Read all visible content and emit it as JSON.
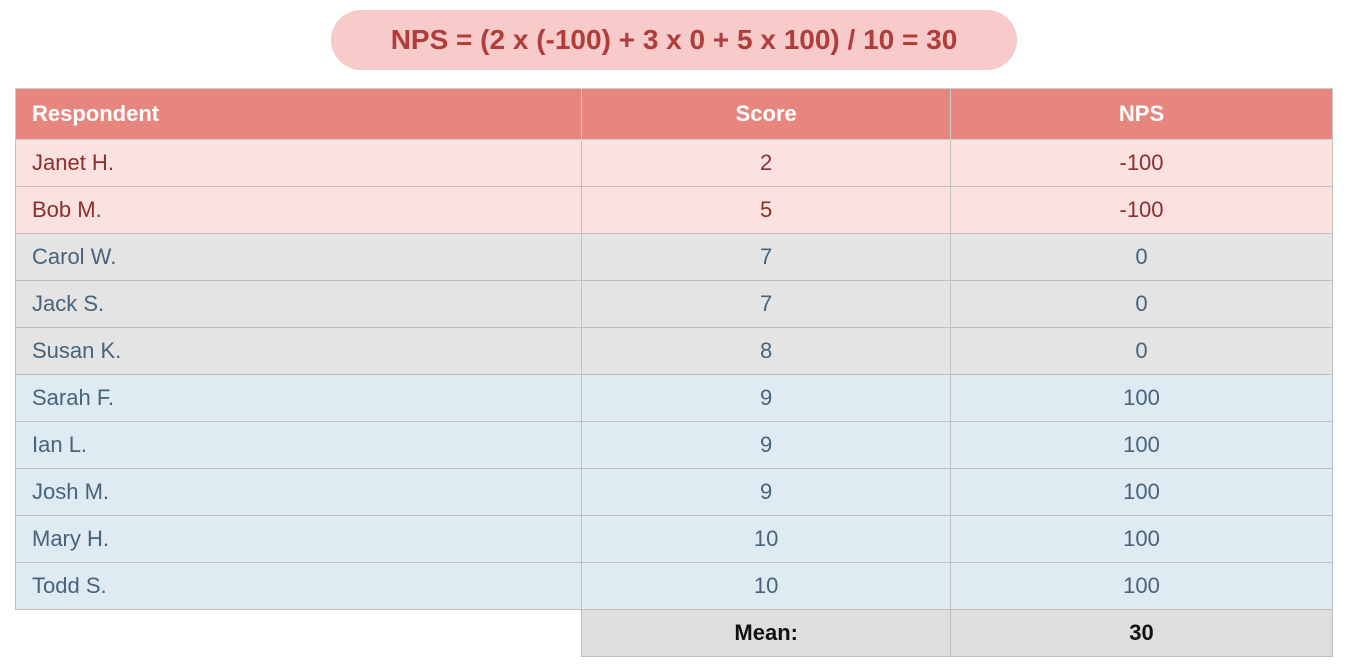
{
  "formula": "NPS = (2 x (-100) + 3 x 0 + 5 x 100) / 10 = 30",
  "headers": {
    "respondent": "Respondent",
    "score": "Score",
    "nps": "NPS"
  },
  "rows": [
    {
      "name": "Janet H.",
      "score": "2",
      "nps": "-100",
      "group": "detractor"
    },
    {
      "name": "Bob M.",
      "score": "5",
      "nps": "-100",
      "group": "detractor"
    },
    {
      "name": "Carol W.",
      "score": "7",
      "nps": "0",
      "group": "passive"
    },
    {
      "name": "Jack S.",
      "score": "7",
      "nps": "0",
      "group": "passive"
    },
    {
      "name": "Susan K.",
      "score": "8",
      "nps": "0",
      "group": "passive"
    },
    {
      "name": "Sarah F.",
      "score": "9",
      "nps": "100",
      "group": "promoter"
    },
    {
      "name": "Ian L.",
      "score": "9",
      "nps": "100",
      "group": "promoter"
    },
    {
      "name": "Josh M.",
      "score": "9",
      "nps": "100",
      "group": "promoter"
    },
    {
      "name": "Mary H.",
      "score": "10",
      "nps": "100",
      "group": "promoter"
    },
    {
      "name": "Todd S.",
      "score": "10",
      "nps": "100",
      "group": "promoter"
    }
  ],
  "mean": {
    "label": "Mean:",
    "value": "30"
  },
  "chart_data": {
    "type": "table",
    "title": "NPS by respondent",
    "columns": [
      "Respondent",
      "Score",
      "NPS"
    ],
    "data": [
      [
        "Janet H.",
        2,
        -100
      ],
      [
        "Bob M.",
        5,
        -100
      ],
      [
        "Carol W.",
        7,
        0
      ],
      [
        "Jack S.",
        7,
        0
      ],
      [
        "Susan K.",
        8,
        0
      ],
      [
        "Sarah F.",
        9,
        100
      ],
      [
        "Ian L.",
        9,
        100
      ],
      [
        "Josh M.",
        9,
        100
      ],
      [
        "Mary H.",
        10,
        100
      ],
      [
        "Todd S.",
        10,
        100
      ]
    ],
    "summary": {
      "mean_nps": 30
    },
    "formula": "NPS = (2 × (-100) + 3 × 0 + 5 × 100) / 10 = 30"
  }
}
